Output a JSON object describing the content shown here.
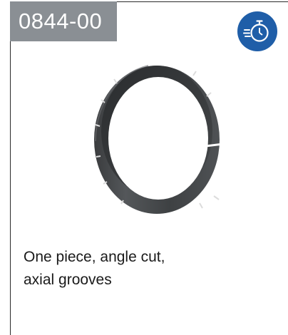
{
  "product": {
    "part_number": "0844-00",
    "caption_line1": "One piece, angle cut,",
    "caption_line2": "axial grooves",
    "badge_color": "#8a8f94",
    "icon_color": "#1f5ea8",
    "icon": "stopwatch-speed-icon"
  }
}
